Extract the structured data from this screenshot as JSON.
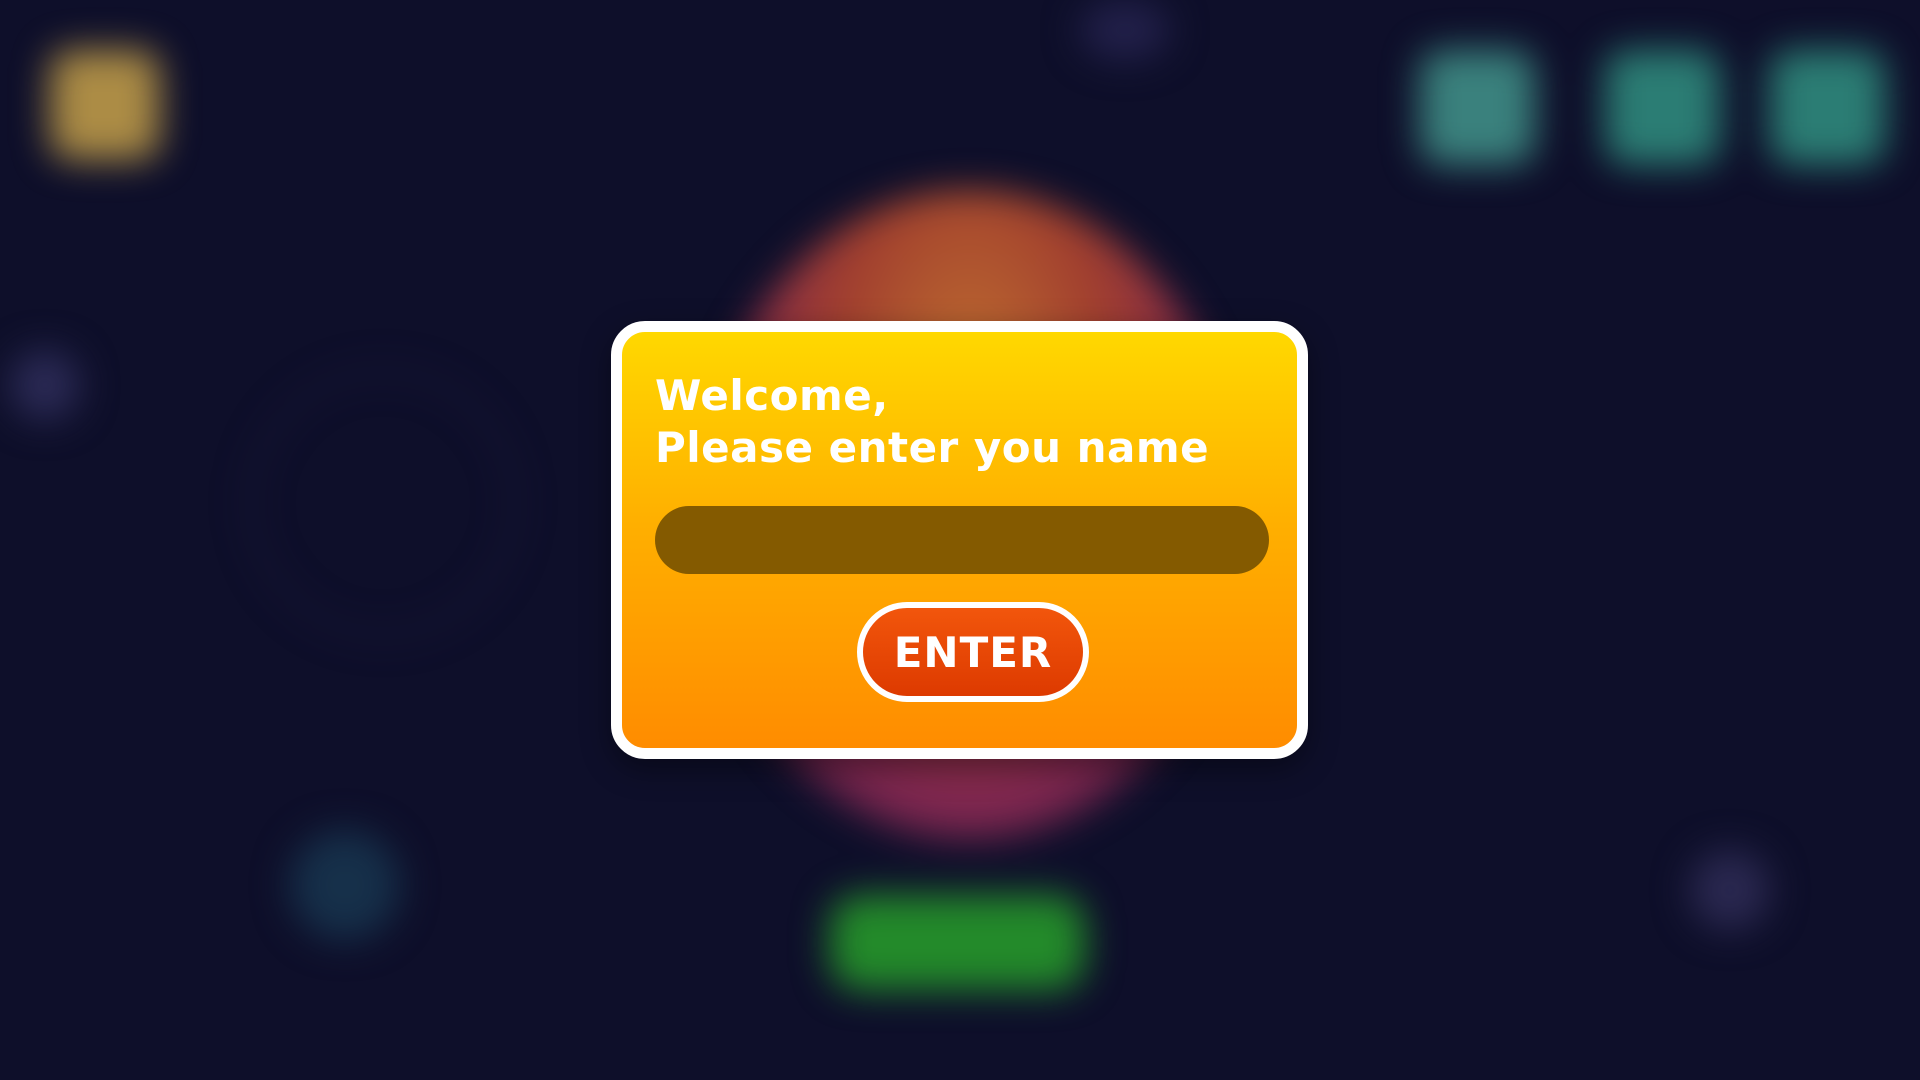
{
  "dialog": {
    "title_line1": "Welcome,",
    "title_line2": "Please enter you name",
    "name_input": {
      "value": "",
      "placeholder": ""
    },
    "enter_label": "ENTER"
  },
  "colors": {
    "background": "#0e0f2a",
    "dialog_top": "#ffd800",
    "dialog_bottom": "#ff8c00",
    "input_fill": "#845a00",
    "button_fill": "#dd3a00",
    "border": "#ffffff"
  }
}
